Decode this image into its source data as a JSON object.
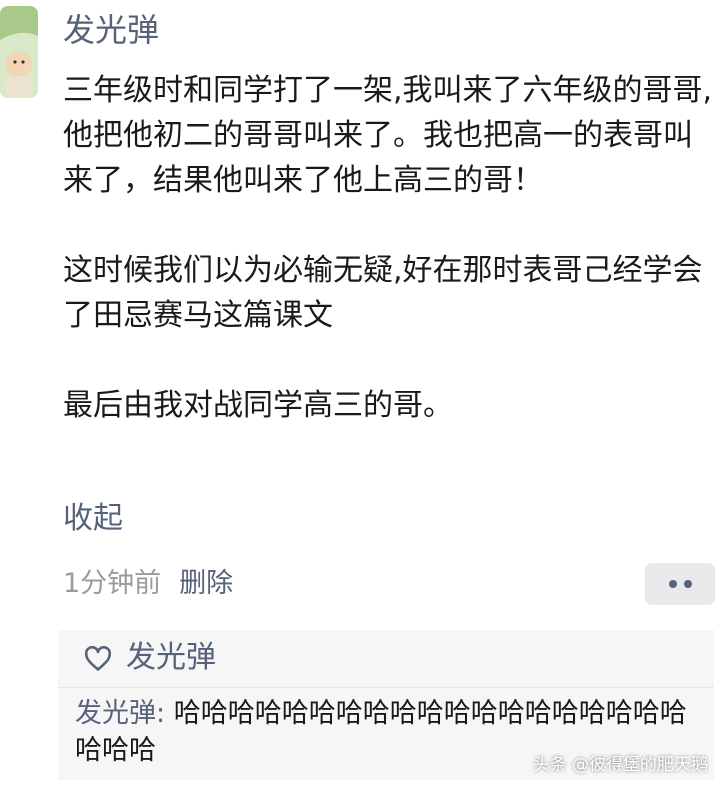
{
  "post": {
    "author": "发光弹",
    "paragraphs": [
      "三年级时和同学打了一架,我叫来了六年级的哥哥,他把他初二的哥哥叫来了。我也把高一的表哥叫来了，结果他叫来了他上高三的哥！",
      "这时候我们以为必输无疑,好在那时表哥己经学会了田忌赛马这篇课文",
      "最后由我对战同学高三的哥。"
    ],
    "collapse_label": "收起",
    "time": "1分钟前",
    "delete_label": "删除"
  },
  "likes": {
    "names": "发光弹"
  },
  "comments": [
    {
      "author": "发光弹:",
      "text": "哈哈哈哈哈哈哈哈哈哈哈哈哈哈哈哈哈哈哈哈哈哈"
    }
  ],
  "watermark": "头条 @彼得堡的肥天鹅",
  "colors": {
    "link": "#56627a",
    "text": "#1a1a1a",
    "meta": "#9b9b9b",
    "panel": "#f6f6f6"
  },
  "icons": {
    "like": "heart-outline-icon",
    "more": "more-dots-icon"
  }
}
